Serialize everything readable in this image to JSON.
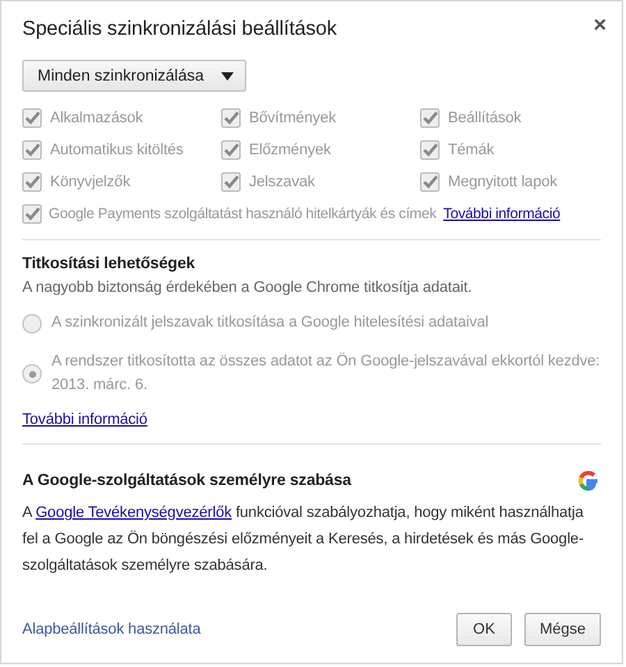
{
  "dialog": {
    "title": "Speciális szinkronizálási beállítások",
    "close": "×"
  },
  "sync_mode": {
    "label": "Minden szinkronizálása"
  },
  "sync_items": [
    {
      "label": "Alkalmazások",
      "checked": true,
      "disabled": true
    },
    {
      "label": "Bővítmények",
      "checked": true,
      "disabled": true
    },
    {
      "label": "Beállítások",
      "checked": true,
      "disabled": true
    },
    {
      "label": "Automatikus kitöltés",
      "checked": true,
      "disabled": true
    },
    {
      "label": "Előzmények",
      "checked": true,
      "disabled": true
    },
    {
      "label": "Témák",
      "checked": true,
      "disabled": true
    },
    {
      "label": "Könyvjelzők",
      "checked": true,
      "disabled": true
    },
    {
      "label": "Jelszavak",
      "checked": true,
      "disabled": true
    },
    {
      "label": "Megnyitott lapok",
      "checked": true,
      "disabled": true
    }
  ],
  "payments": {
    "label": "Google Payments szolgáltatást használó hitelkártyák és címek",
    "checked": true,
    "disabled": true,
    "link": "További információ"
  },
  "encryption": {
    "heading": "Titkosítási lehetőségek",
    "description": "A nagyobb biztonság érdekében a Google Chrome titkosítja adatait.",
    "options": [
      {
        "label": "A szinkronizált jelszavak titkosítása a Google hitelesítési adataival",
        "selected": false,
        "disabled": true
      },
      {
        "label": "A rendszer titkosította az összes adatot az Ön Google-jelszavával ekkortól kezdve: 2013. márc. 6.",
        "selected": true,
        "disabled": true
      }
    ],
    "link": "További információ"
  },
  "personalization": {
    "heading": "A Google-szolgáltatások személyre szabása",
    "text_before": "A ",
    "link": "Google Tevékenységvezérlők",
    "text_after": " funkcióval szabályozhatja, hogy miként használhatja fel a Google az Ön böngészési előzményeit a Keresés, a hirdetések és más Google-szolgáltatások személyre szabására."
  },
  "footer": {
    "link": "Alapbeállítások használata",
    "buttons": [
      "OK",
      "Mégse"
    ]
  }
}
